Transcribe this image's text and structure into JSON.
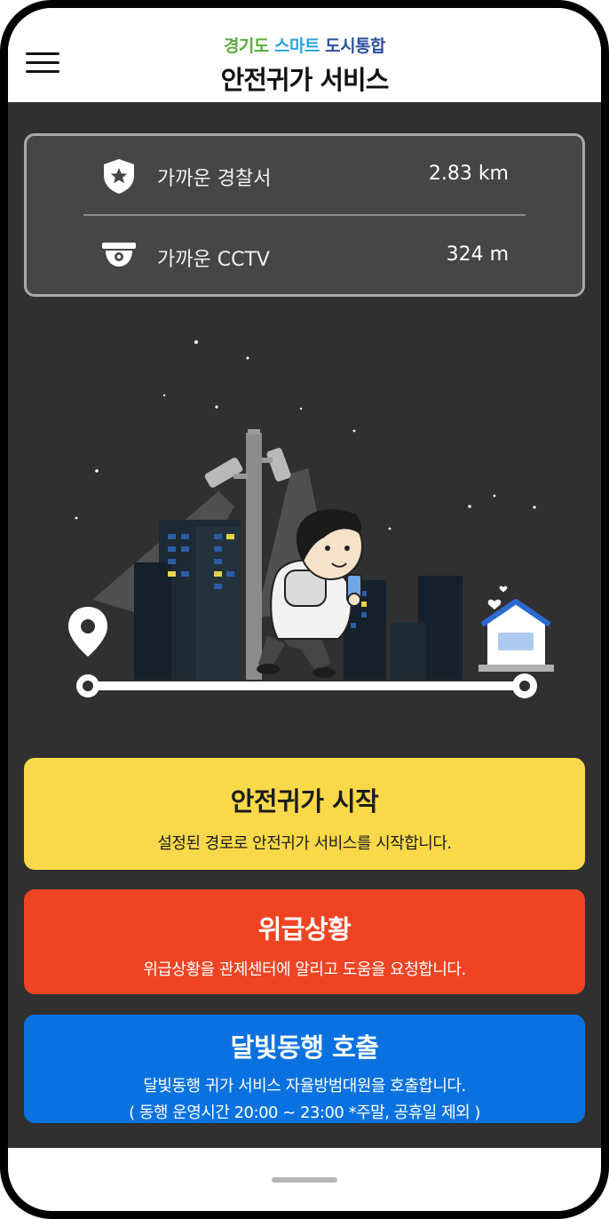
{
  "header": {
    "subtitle_part1": "경기도",
    "subtitle_part2": "스마트",
    "subtitle_part3": "도시통합",
    "title": "안전귀가 서비스"
  },
  "nearby": {
    "police": {
      "label": "가까운 경찰서",
      "value": "2.83 km",
      "icon": "police-shield-icon"
    },
    "cctv": {
      "label": "가까운 CCTV",
      "value": "324 m",
      "icon": "cctv-icon"
    }
  },
  "actions": {
    "start": {
      "title": "안전귀가 시작",
      "desc": "설정된 경로로 안전귀가 서비스를 시작합니다."
    },
    "emergency": {
      "title": "위급상황",
      "desc": "위급상황을 관제센터에 알리고 도움을 요청합니다."
    },
    "escort": {
      "title": "달빛동행 호출",
      "desc": "달빛동행 귀가 서비스 자율방범대원을 호출합니다.",
      "desc2": "( 동행 운영시간 20:00 ~ 23:00 *주말, 공휴일 제외 )"
    }
  },
  "colors": {
    "start": "#f9d949",
    "emergency": "#ee4424",
    "escort": "#0a72e0",
    "background": "#303030"
  }
}
